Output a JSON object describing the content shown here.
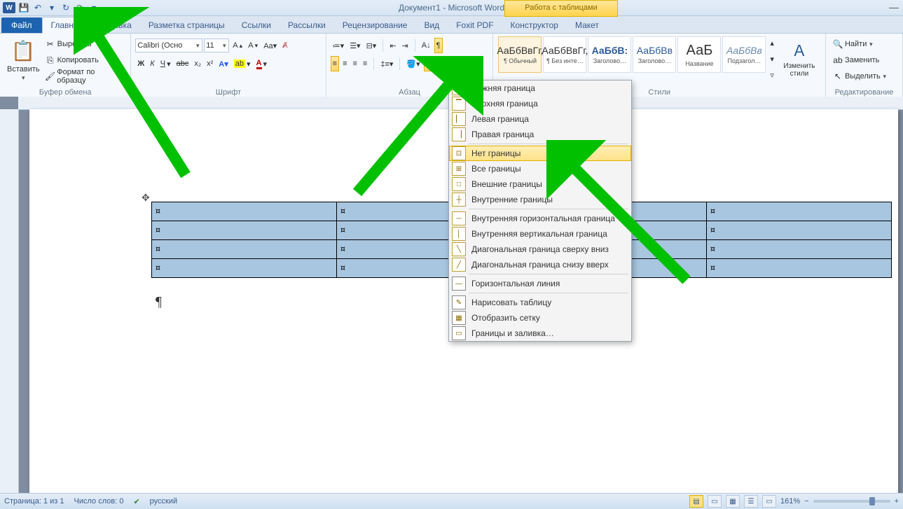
{
  "title": "Документ1 - Microsoft Word",
  "table_tools": "Работа с таблицами",
  "tabs": {
    "file": "Файл",
    "home": "Главная",
    "insert": "Вставка",
    "layout": "Разметка страницы",
    "refs": "Ссылки",
    "mail": "Рассылки",
    "review": "Рецензирование",
    "view": "Вид",
    "foxit": "Foxit PDF",
    "design": "Конструктор",
    "tlayout": "Макет"
  },
  "clipboard": {
    "paste": "Вставить",
    "cut": "Вырезать",
    "copy": "Копировать",
    "fmt": "Формат по образцу",
    "group": "Буфер обмена"
  },
  "font": {
    "name": "Calibri (Осно",
    "size": "11",
    "group": "Шрифт"
  },
  "para": {
    "group": "Абзац"
  },
  "styles": {
    "s1": "¶ Обычный",
    "s2": "¶ Без инте…",
    "s3": "Заголово…",
    "s4": "Заголово…",
    "s5": "Название",
    "s6": "Подзагол…",
    "change": "Изменить стили",
    "group": "Стили",
    "p1": "АаБбВвГг,",
    "p2": "АаБбВвГг,",
    "p3": "АаБбВ:",
    "p4": "АаБбВв",
    "p5": "АаБ",
    "p6": "АаБбВв"
  },
  "editing": {
    "find": "Найти",
    "replace": "Заменить",
    "select": "Выделить",
    "group": "Редактирование"
  },
  "border_menu": {
    "bottom": "Нижняя граница",
    "top": "Верхняя граница",
    "left": "Левая граница",
    "right": "Правая граница",
    "none": "Нет границы",
    "all": "Все границы",
    "outer": "Внешние границы",
    "inner": "Внутренние границы",
    "ihor": "Внутренняя горизонтальная граница",
    "ivert": "Внутренняя вертикальная граница",
    "diag1": "Диагональная граница сверху вниз",
    "diag2": "Диагональная граница снизу вверх",
    "hline": "Горизонтальная линия",
    "draw": "Нарисовать таблицу",
    "grid": "Отобразить сетку",
    "dlg": "Границы и заливка…"
  },
  "status": {
    "page": "Страница: 1 из 1",
    "words": "Число слов: 0",
    "lang": "русский",
    "zoom": "161%"
  },
  "cell": "¤",
  "pilcrow": "¶"
}
